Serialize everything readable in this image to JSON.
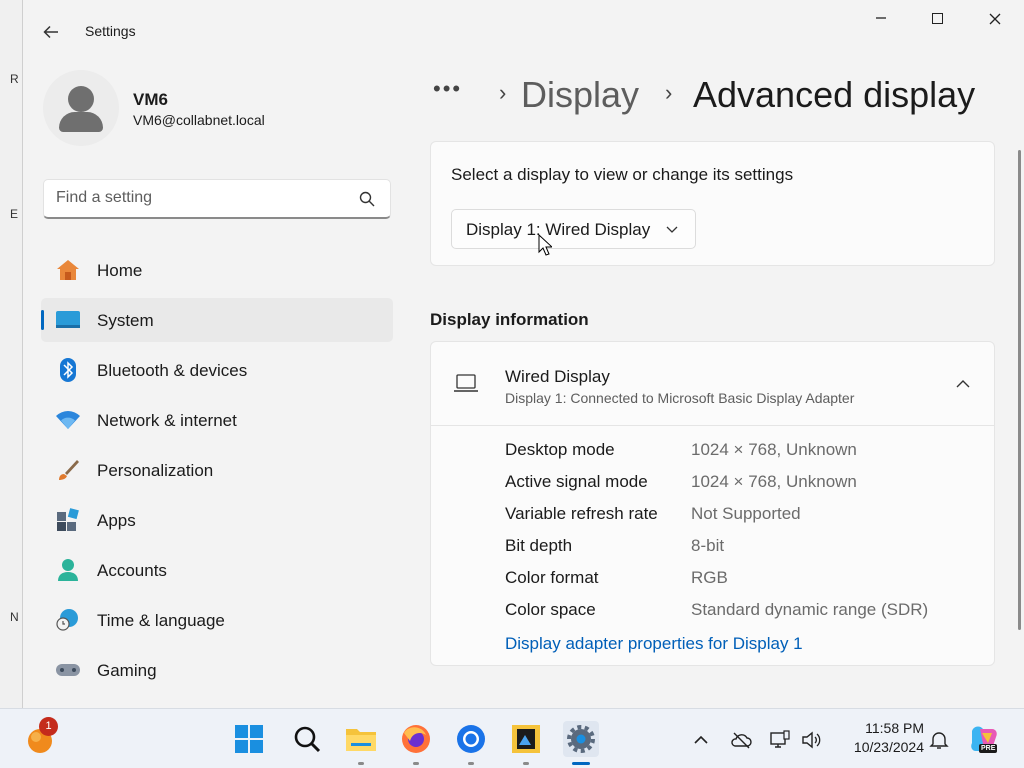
{
  "window": {
    "app_title": "Settings",
    "controls": {
      "minimize": "—",
      "close": "✕"
    }
  },
  "profile": {
    "name": "VM6",
    "email": "VM6@collabnet.local"
  },
  "search": {
    "placeholder": "Find a setting"
  },
  "nav": {
    "items": [
      {
        "label": "Home",
        "icon": "home-icon",
        "active": false
      },
      {
        "label": "System",
        "icon": "system-icon",
        "active": true
      },
      {
        "label": "Bluetooth & devices",
        "icon": "bluetooth-icon",
        "active": false
      },
      {
        "label": "Network & internet",
        "icon": "wifi-icon",
        "active": false
      },
      {
        "label": "Personalization",
        "icon": "brush-icon",
        "active": false
      },
      {
        "label": "Apps",
        "icon": "apps-icon",
        "active": false
      },
      {
        "label": "Accounts",
        "icon": "accounts-icon",
        "active": false
      },
      {
        "label": "Time & language",
        "icon": "globe-clock-icon",
        "active": false
      },
      {
        "label": "Gaming",
        "icon": "gamepad-icon",
        "active": false
      }
    ]
  },
  "breadcrumb": {
    "more": "•••",
    "separator": "›",
    "parent": "Display",
    "current": "Advanced display"
  },
  "display_select": {
    "title": "Select a display to view or change its settings",
    "selected": "Display 1: Wired Display"
  },
  "display_info": {
    "section_title": "Display information",
    "name": "Wired Display",
    "subtitle": "Display 1: Connected to Microsoft Basic Display Adapter",
    "rows": [
      {
        "label": "Desktop mode",
        "value": "1024 × 768, Unknown"
      },
      {
        "label": "Active signal mode",
        "value": "1024 × 768, Unknown"
      },
      {
        "label": "Variable refresh rate",
        "value": "Not Supported"
      },
      {
        "label": "Bit depth",
        "value": "8-bit"
      },
      {
        "label": "Color format",
        "value": "RGB"
      },
      {
        "label": "Color space",
        "value": "Standard dynamic range (SDR)"
      }
    ],
    "link": "Display adapter properties for Display 1"
  },
  "taskbar": {
    "notification_badge": "1",
    "time": "11:58 PM",
    "date": "10/23/2024",
    "copilot_tag": "PRE"
  },
  "colors": {
    "accent": "#0067c0",
    "link": "#005fb8",
    "badge": "#c42b1c"
  }
}
